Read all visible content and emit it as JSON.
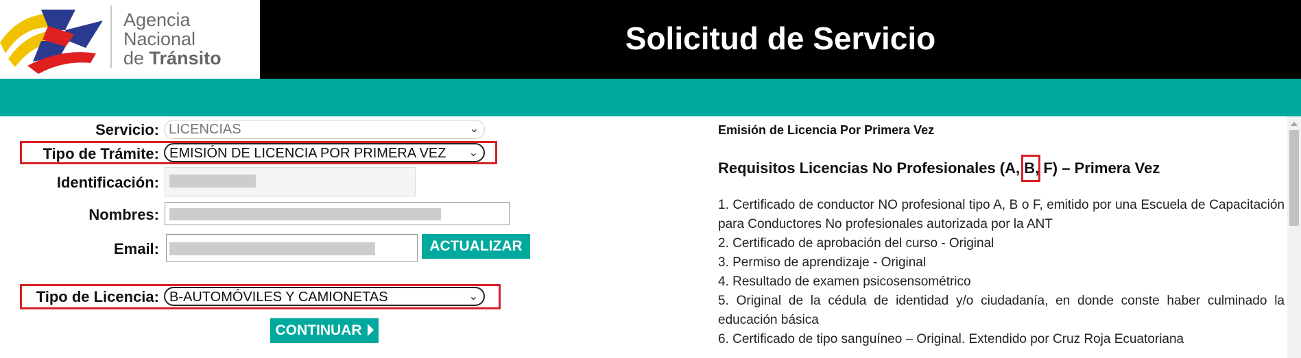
{
  "header": {
    "logo_line1": "Agencia",
    "logo_line2": "Nacional",
    "logo_line3_prefix": "de ",
    "logo_line3_bold": "Tránsito",
    "title": "Solicitud de Servicio"
  },
  "form": {
    "servicio_label": "Servicio:",
    "servicio_value": "LICENCIAS",
    "tipo_tramite_label": "Tipo de Trámite:",
    "tipo_tramite_value": "EMISIÓN DE LICENCIA POR PRIMERA VEZ",
    "identificacion_label": "Identificación:",
    "nombres_label": "Nombres:",
    "email_label": "Email:",
    "actualizar_label": "ACTUALIZAR",
    "tipo_licencia_label": "Tipo de Licencia:",
    "tipo_licencia_value": "B-AUTOMÓVILES Y CAMIONETAS",
    "continuar_label": "CONTINUAR"
  },
  "requirements": {
    "subtitle": "Emisión de Licencia Por Primera Vez",
    "heading_before": "Requisitos Licencias No Profesionales (A, ",
    "heading_highlight": "B",
    "heading_after": ", F) – Primera Vez",
    "items": [
      "1. Certificado de conductor NO profesional tipo A, B o F, emitido por una Escuela de Capacitación para Conductores No profesionales autorizada por la ANT",
      "2. Certificado de aprobación del curso - Original",
      "3. Permiso de aprendizaje - Original",
      "4. Resultado de examen psicosensométrico",
      "5. Original de la cédula de identidad y/o ciudadanía, en donde conste haber culminado la educación básica",
      "6. Certificado de tipo sanguíneo – Original. Extendido por Cruz Roja Ecuatoriana"
    ]
  },
  "colors": {
    "header_bg": "#000000",
    "accent_teal": "#00a99d",
    "highlight_red": "#d62026"
  }
}
